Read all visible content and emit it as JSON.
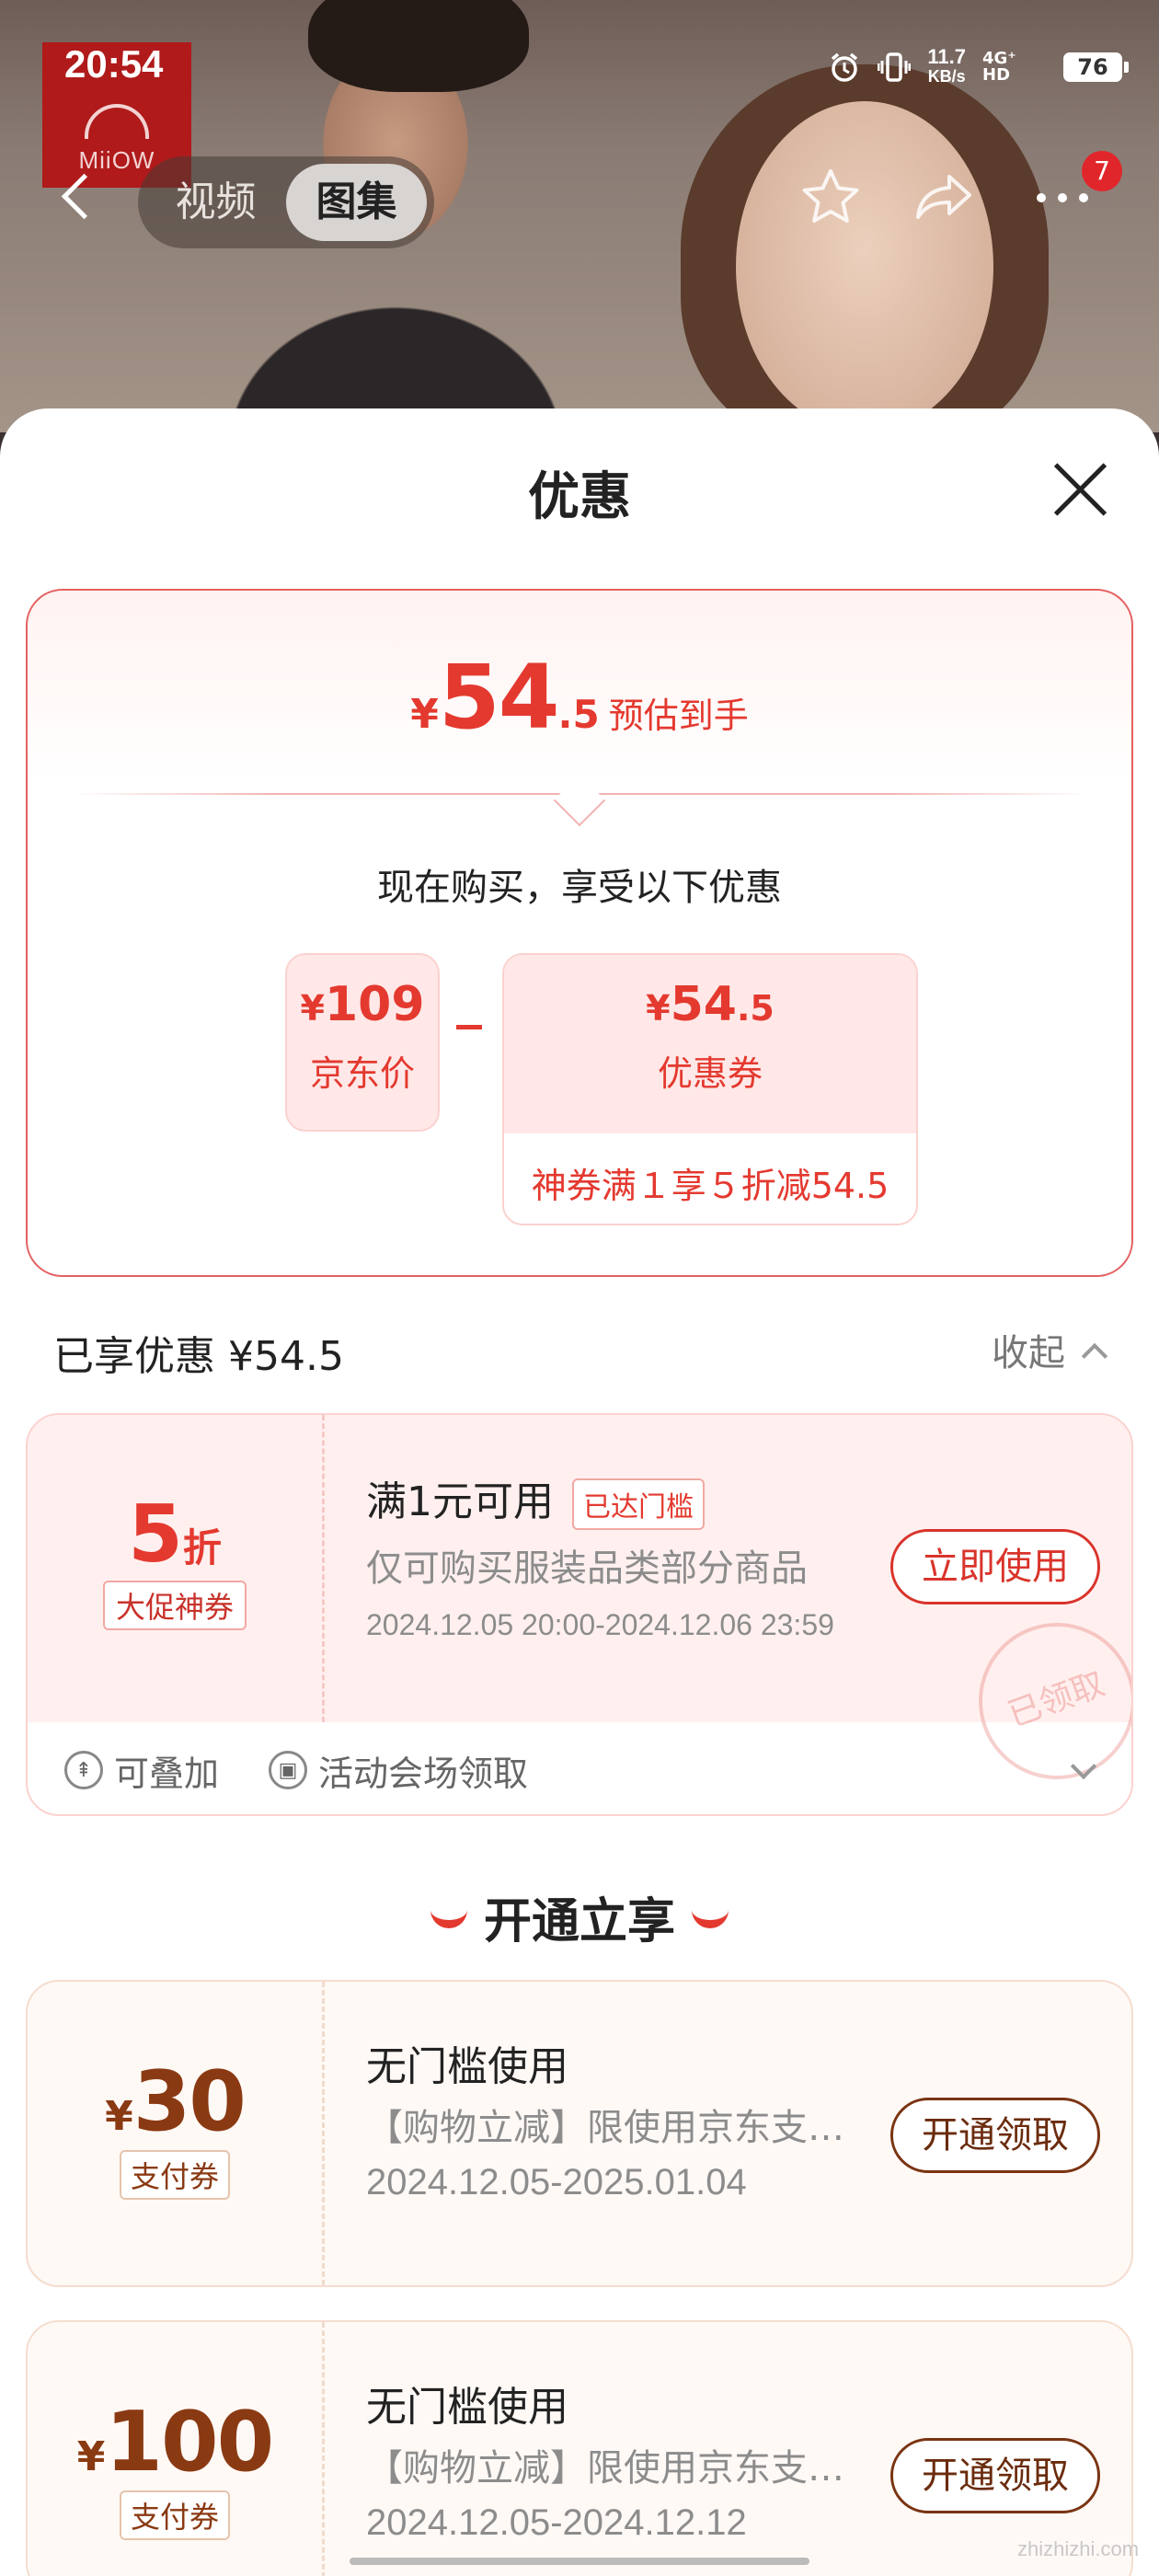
{
  "status_bar": {
    "time": "20:54",
    "net_speed": "11.7",
    "net_unit": "KB/s",
    "network": "4G⁺ HD",
    "battery": "76"
  },
  "brand": {
    "logo_text": "MiiOW"
  },
  "nav": {
    "tab_video": "视频",
    "tab_gallery": "图集",
    "cart_count": "7"
  },
  "sheet": {
    "title": "优惠"
  },
  "summary": {
    "est_currency": "¥",
    "est_int": "54",
    "est_dec": ".5",
    "est_label": "预估到手",
    "buy_now": "现在购买，享受以下优惠",
    "jd_price": {
      "currency": "¥",
      "value": "109",
      "label": "京东价"
    },
    "coupon_price": {
      "currency": "¥",
      "value": "54",
      "dec": ".5",
      "label": "优惠券"
    },
    "coupon_desc": "神券满１享５折减54.5"
  },
  "enjoyed": {
    "label": "已享优惠 ¥54.5",
    "collapse": "收起"
  },
  "coupon_main": {
    "discount": "5",
    "discount_unit": "折",
    "tag": "大促神券",
    "title": "满1元可用",
    "reached": "已达门槛",
    "desc": "仅可购买服装品类部分商品",
    "date": "2024.12.05 20:00-2024.12.06 23:59",
    "button": "立即使用",
    "stamp": "已领取",
    "foot_stack": "可叠加",
    "foot_source": "活动会场领取"
  },
  "section_title": "开通立享",
  "pay_coupons": [
    {
      "currency": "¥",
      "amount": "30",
      "tag": "支付券",
      "title": "无门槛使用",
      "desc": "【购物立减】限使用京东支…",
      "date": "2024.12.05-2025.01.04",
      "button": "开通领取"
    },
    {
      "currency": "¥",
      "amount": "100",
      "tag": "支付券",
      "title": "无门槛使用",
      "desc": "【购物立减】限使用京东支…",
      "date": "2024.12.05-2024.12.12",
      "button": "开通领取"
    }
  ],
  "watermark": "zhizhizhi.com",
  "colors": {
    "accent": "#e4392f",
    "brown": "#7a3412"
  }
}
